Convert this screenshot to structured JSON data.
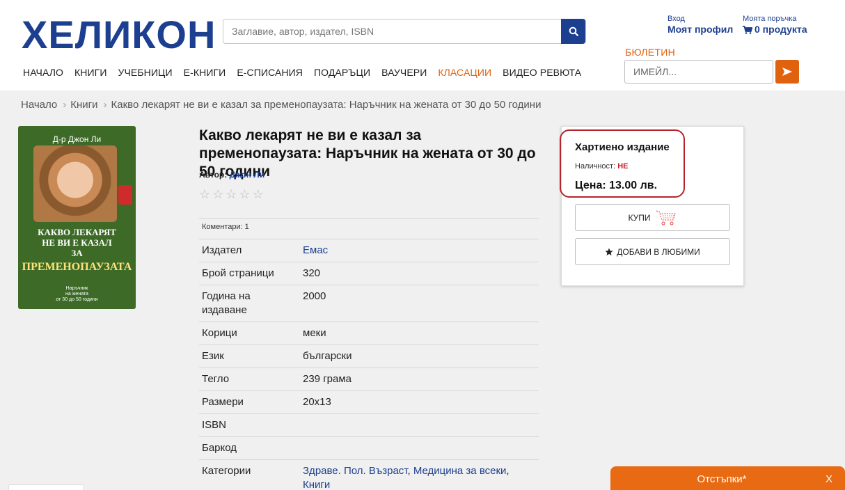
{
  "header": {
    "logo": "ХЕЛИКОН",
    "search_placeholder": "Заглавие, автор, издател, ISBN",
    "login_label": "Вход",
    "profile_label": "Моят профил",
    "order_label": "Моята поръчка",
    "cart_label": "0 продукта",
    "newsletter_label": "БЮЛЕТИН",
    "email_placeholder": "ИМЕЙЛ...",
    "nav": [
      {
        "label": "НАЧАЛО"
      },
      {
        "label": "КНИГИ"
      },
      {
        "label": "УЧЕБНИЦИ"
      },
      {
        "label": "Е-КНИГИ"
      },
      {
        "label": "Е-СПИСАНИЯ"
      },
      {
        "label": "ПОДАРЪЦИ"
      },
      {
        "label": "ВАУЧЕРИ"
      },
      {
        "label": "КЛАСАЦИИ"
      },
      {
        "label": "ВИДЕО РЕВЮТА"
      }
    ],
    "accent_color": "#e0620f",
    "brand_color": "#1d3f8f"
  },
  "breadcrumb": {
    "home": "Начало",
    "books": "Книги",
    "current": "Какво лекарят не ви е казал за пременопаузата: Наръчник на жената от 30 до 50 години"
  },
  "cover": {
    "author": "Д-р Джон Ли",
    "title_line1": "КАКВО ЛЕКАРЯТ",
    "title_line2": "НЕ ВИ Е КАЗАЛ",
    "title_line3": "ЗА",
    "title_big": "ПРЕМЕНОПАУЗАТА",
    "subtitle_line1": "Наръчник",
    "subtitle_line2": "на жената",
    "subtitle_line3": "от 30 до 50 години"
  },
  "book": {
    "title": "Какво лекарят не ви е казал за пременопаузата: Наръчник на жената от 30 до 50 години",
    "author_label": "Автор:",
    "author": "Джон Ли",
    "rating": 0,
    "comments": "Коментари: 1",
    "details": {
      "publisher_key": "Издател",
      "publisher": "Емас",
      "pages_key": "Брой страници",
      "pages": "320",
      "year_key": "Година на издаване",
      "year": "2000",
      "cover_key": "Корици",
      "cover_type": "меки",
      "language_key": "Език",
      "language": "български",
      "weight_key": "Тегло",
      "weight": "239 грама",
      "size_key": "Размери",
      "size": "20x13",
      "isbn_key": "ISBN",
      "isbn": "",
      "barcode_key": "Баркод",
      "barcode": "",
      "categories_key": "Категории",
      "category1": "Здраве. Пол. Възраст",
      "category2": "Медицина за всеки",
      "category3": "Книги"
    }
  },
  "buy_panel": {
    "edition": "Хартиено издание",
    "availability_label": "Наличност:",
    "availability_value": "НЕ",
    "price": "Цена: 13.00 лв.",
    "buy_label": "КУПИ",
    "favorite_label": "ДОБАВИ В ЛЮБИМИ"
  },
  "discount_bar": {
    "label": "Отстъпки*",
    "close": "X"
  }
}
